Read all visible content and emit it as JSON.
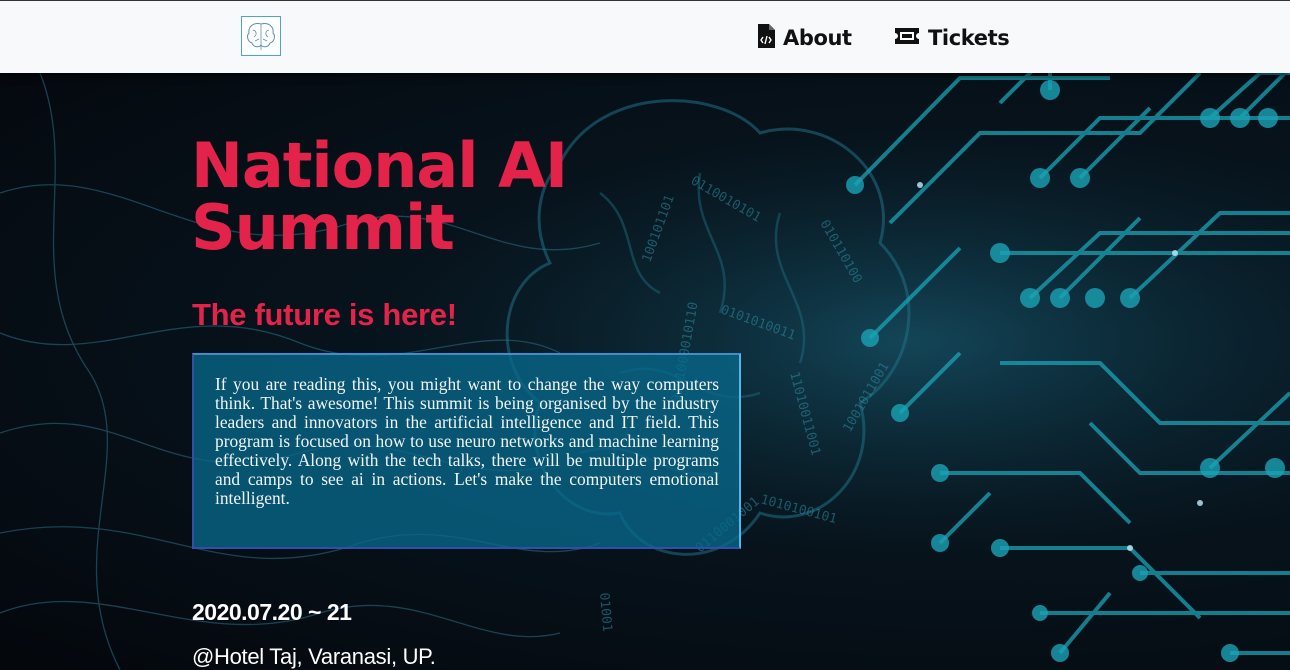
{
  "nav": {
    "logo_icon": "brain-logo-icon",
    "about_icon": "code-file-icon",
    "about_label": "About",
    "tickets_icon": "ticket-icon",
    "tickets_label": "Tickets"
  },
  "hero": {
    "title": "National AI Summit",
    "tagline": "The future is here!",
    "description": "If you are reading this, you might want to change the way computers think. That's awesome! This summit is being organised by the industry leaders and innovators in the artificial intelligence and IT field. This program is focused on how to use neuro networks and machine learning effectively. Along with the tech talks, there will be multiple programs and camps to see ai in actions. Let's make the computers emotional intelligent.",
    "date": "2020.07.20 ~ 21",
    "venue": "@Hotel Taj, Varanasi, UP."
  },
  "colors": {
    "accent": "#e4234a",
    "circuit": "#1aa3b5",
    "box": "#08688a"
  }
}
